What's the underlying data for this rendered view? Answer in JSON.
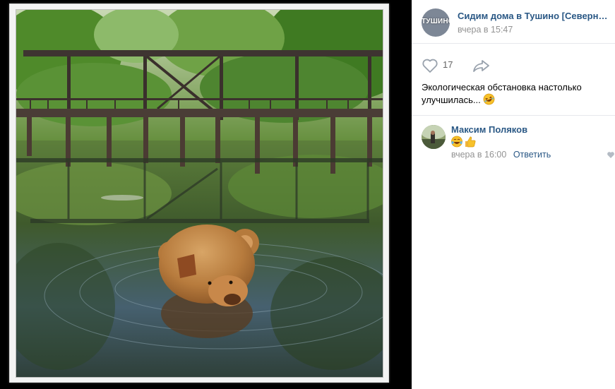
{
  "post": {
    "group_name": "Сидим дома в Тушино [Северном ...",
    "group_avatar_text": "ТУШИНО",
    "time": "вчера в 15:47",
    "likes": "17",
    "text": "Экологическая обстановка настолько улучшилась...",
    "text_emoji": "rolling-on-floor-laughing-emoji"
  },
  "comment": {
    "author": "Максим Поляков",
    "emojis": [
      "face-with-tears-of-joy-emoji",
      "thumbs-up-emoji"
    ],
    "time": "вчера в 16:00",
    "reply_label": "Ответить"
  },
  "photo": {
    "description_icon": "teddy-bear-in-pond-under-bridge"
  },
  "colors": {
    "link": "#2a5885",
    "meta": "#939393",
    "divider": "#e7e8ec",
    "icon": "#99a2ad"
  }
}
